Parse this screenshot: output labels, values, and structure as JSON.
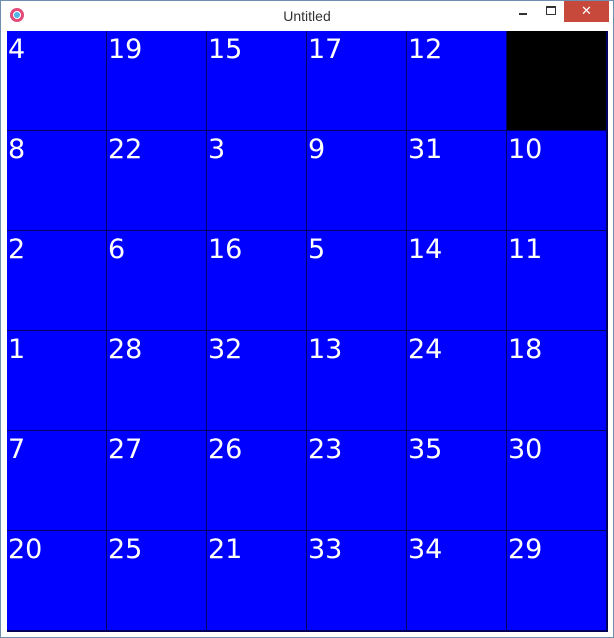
{
  "window": {
    "title": "Untitled",
    "close_glyph": "✕",
    "colors": {
      "tile": "#0000ff",
      "empty": "#000000",
      "text": "#ffffff",
      "close_button": "#c7493c"
    }
  },
  "board": {
    "rows": 6,
    "cols": 6,
    "tiles": [
      [
        "4",
        "19",
        "15",
        "17",
        "12",
        null
      ],
      [
        "8",
        "22",
        "3",
        "9",
        "31",
        "10"
      ],
      [
        "2",
        "6",
        "16",
        "5",
        "14",
        "11"
      ],
      [
        "1",
        "28",
        "32",
        "13",
        "24",
        "18"
      ],
      [
        "7",
        "27",
        "26",
        "23",
        "35",
        "30"
      ],
      [
        "20",
        "25",
        "21",
        "33",
        "34",
        "29"
      ]
    ]
  }
}
